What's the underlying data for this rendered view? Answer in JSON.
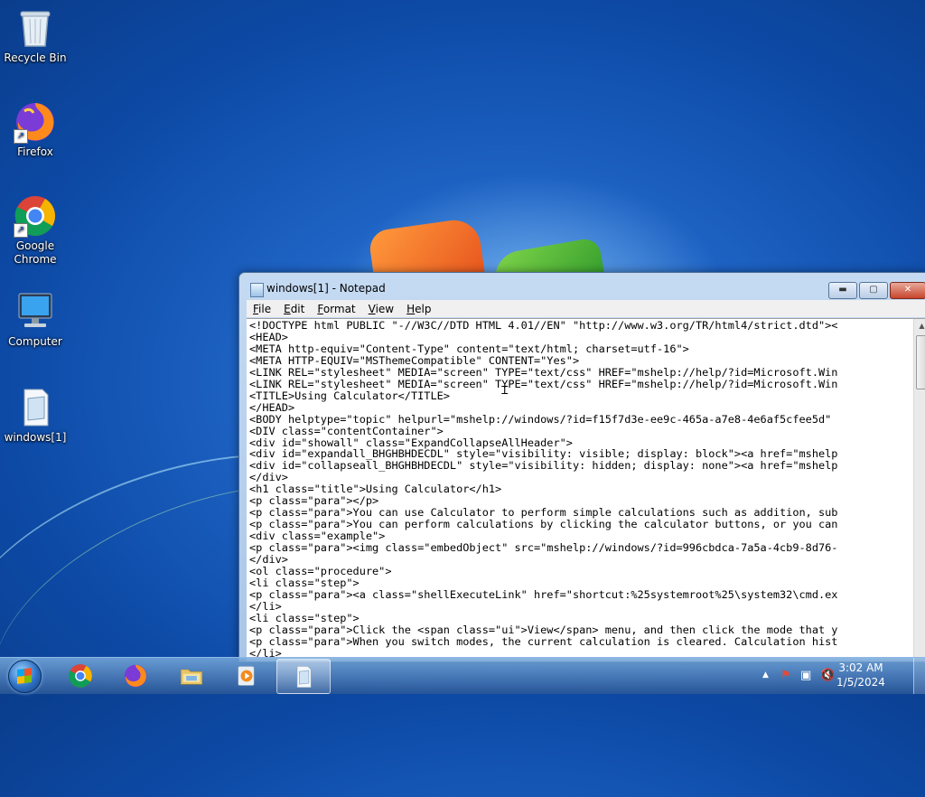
{
  "desktop": {
    "icons": [
      {
        "label": "Recycle Bin",
        "icon": "recycle-bin-icon"
      },
      {
        "label": "Firefox",
        "icon": "firefox-icon"
      },
      {
        "label": "Google Chrome",
        "icon": "chrome-icon"
      },
      {
        "label": "Computer",
        "icon": "computer-icon"
      },
      {
        "label": "windows[1]",
        "icon": "text-file-icon"
      }
    ]
  },
  "notepad": {
    "title": "windows[1] - Notepad",
    "controls": {
      "minimize": "▬",
      "maximize": "▢",
      "close": "✕"
    },
    "menu": [
      "File",
      "Edit",
      "Format",
      "View",
      "Help"
    ],
    "lines": [
      "<!DOCTYPE html PUBLIC \"-//W3C//DTD HTML 4.01//EN\" \"http://www.w3.org/TR/html4/strict.dtd\"><",
      "<HEAD>",
      "<META http-equiv=\"Content-Type\" content=\"text/html; charset=utf-16\">",
      "<META HTTP-EQUIV=\"MSThemeCompatible\" CONTENT=\"Yes\">",
      "<LINK REL=\"stylesheet\" MEDIA=\"screen\" TYPE=\"text/css\" HREF=\"mshelp://help/?id=Microsoft.Win",
      "<LINK REL=\"stylesheet\" MEDIA=\"screen\" TYPE=\"text/css\" HREF=\"mshelp://help/?id=Microsoft.Win",
      "<TITLE>Using Calculator</TITLE>",
      "</HEAD>",
      "<BODY helptype=\"topic\" helpurl=\"mshelp://windows/?id=f15f7d3e-ee9c-465a-a7e8-4e6af5cfee5d\"",
      "<DIV class=\"contentContainer\">",
      "<div id=\"showall\" class=\"ExpandCollapseAllHeader\">",
      "<div id=\"expandall_BHGHBHDECDL\" style=\"visibility: visible; display: block\"><a href=\"mshelp",
      "<div id=\"collapseall_BHGHBHDECDL\" style=\"visibility: hidden; display: none\"><a href=\"mshelp",
      "</div>",
      "<h1 class=\"title\">Using Calculator</h1>",
      "<p class=\"para\"></p>",
      "<p class=\"para\">You can use Calculator to perform simple calculations such as addition, sub",
      "<p class=\"para\">You can perform calculations by clicking the calculator buttons, or you can",
      "<div class=\"example\">",
      "<p class=\"para\"><img class=\"embedObject\" src=\"mshelp://windows/?id=996cbdca-7a5a-4cb9-8d76-",
      "</div>",
      "<ol class=\"procedure\">",
      "<li class=\"step\">",
      "<p class=\"para\"><a class=\"shellExecuteLink\" href=\"shortcut:%25systemroot%25\\system32\\cmd.ex",
      "</li>",
      "<li class=\"step\">",
      "<p class=\"para\">Click the <span class=\"ui\">View</span> menu, and then click the mode that y",
      "<p class=\"para\">When you switch modes, the current calculation is cleared. Calculation hist",
      "</li>"
    ]
  },
  "taskbar": {
    "items": [
      "chrome-icon",
      "firefox-icon",
      "file-explorer-icon",
      "media-player-icon",
      "notepad-icon"
    ],
    "active_index": 4,
    "tray": {
      "chevron": "▲",
      "flag": "⚑",
      "network": "▣",
      "volume": "🔇"
    },
    "time": "3:02 AM",
    "date": "1/5/2024"
  },
  "colors": {
    "accent": "#1e63c4",
    "close": "#c7452c"
  }
}
